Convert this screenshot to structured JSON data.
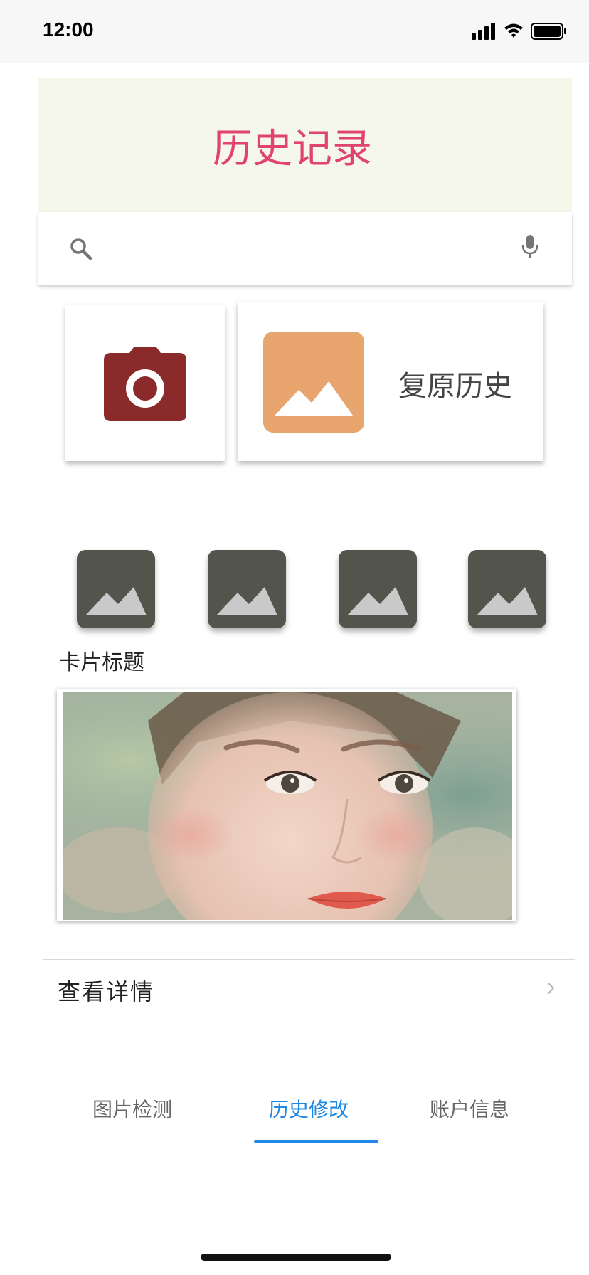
{
  "status_bar": {
    "time": "12:00",
    "icons": [
      "signal-icon",
      "wifi-icon",
      "battery-icon"
    ]
  },
  "header": {
    "title": "历史记录",
    "background": "#f4f7ea",
    "title_color": "#e0436c"
  },
  "search": {
    "placeholder": "",
    "left_icon": "search-icon",
    "right_icon": "mic-icon"
  },
  "actions": {
    "camera": {
      "icon": "camera-icon",
      "color": "#8b2a2a"
    },
    "restore": {
      "icon": "image-icon",
      "label": "复原历史",
      "icon_color": "#e8a56e"
    }
  },
  "thumbnails": [
    {
      "icon": "image-icon"
    },
    {
      "icon": "image-icon"
    },
    {
      "icon": "image-icon"
    },
    {
      "icon": "image-icon"
    }
  ],
  "card": {
    "title": "卡片标题",
    "image": "portrait-photo"
  },
  "details": {
    "label": "查看详情",
    "icon": "chevron-right-icon"
  },
  "tabs": [
    {
      "label": "图片检测",
      "active": false
    },
    {
      "label": "历史修改",
      "active": true
    },
    {
      "label": "账户信息",
      "active": false
    }
  ],
  "accent_color": "#1e88e5"
}
